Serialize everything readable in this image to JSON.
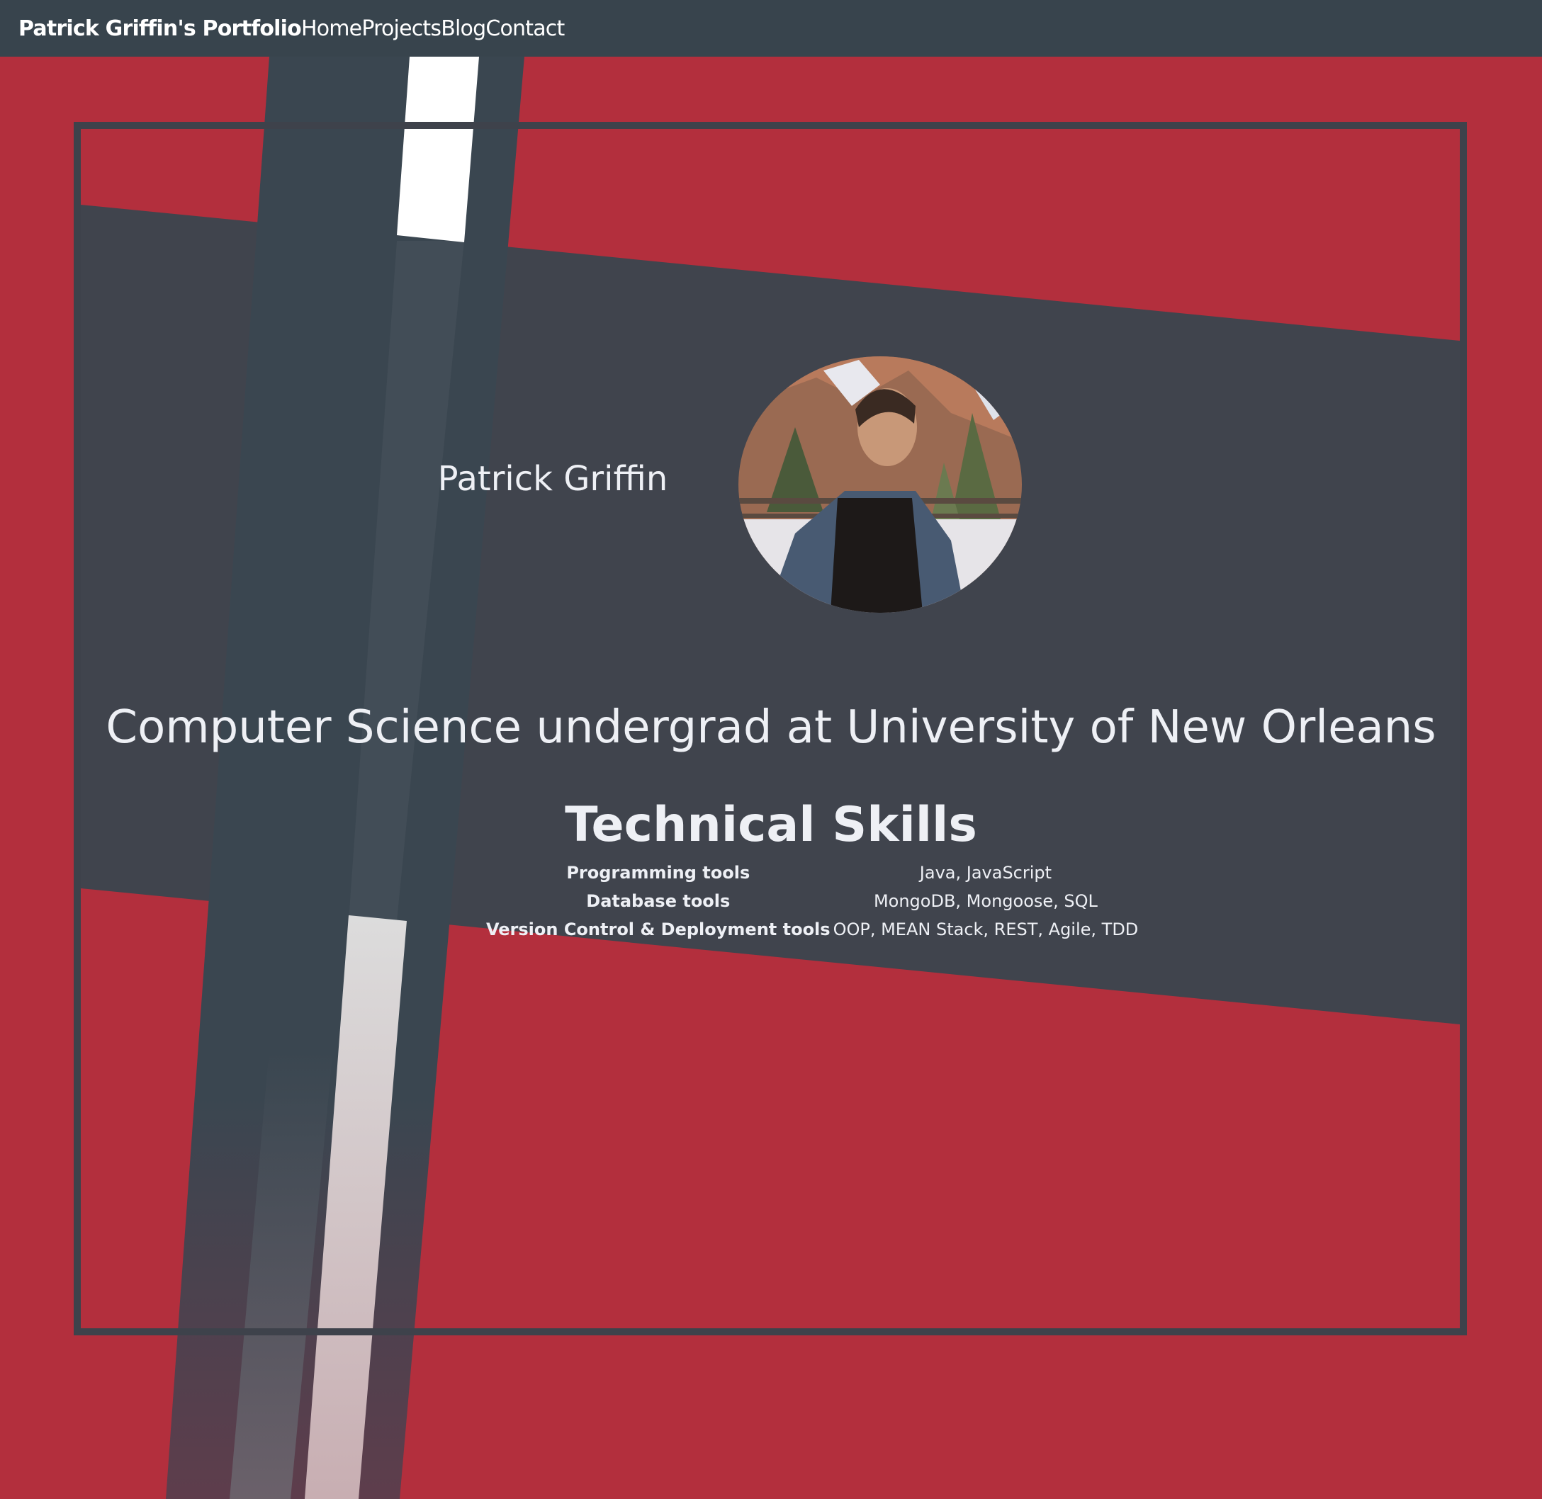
{
  "navbar": {
    "brand": "Patrick Griffin's Portfolio",
    "links": [
      "Home",
      "Projects",
      "Blog",
      "Contact"
    ]
  },
  "profile": {
    "name": "Patrick Griffin",
    "avatar_icon": "profile-photo",
    "tagline": "Computer Science undergrad at University of New Orleans"
  },
  "skills": {
    "heading": "Technical Skills",
    "rows": [
      {
        "label": "Programming tools",
        "value": "Java, JavaScript"
      },
      {
        "label": "Database tools",
        "value": "MongoDB, Mongoose, SQL"
      },
      {
        "label": "Version Control & Deployment tools",
        "value": "OOP, MEAN Stack, REST, Agile, TDD"
      }
    ]
  },
  "colors": {
    "background_red": "#b32f3d",
    "navbar": "#38444d",
    "band_dark": "#40444d",
    "stripe_dark": "#3a4650",
    "text_light": "#eef0f5"
  }
}
